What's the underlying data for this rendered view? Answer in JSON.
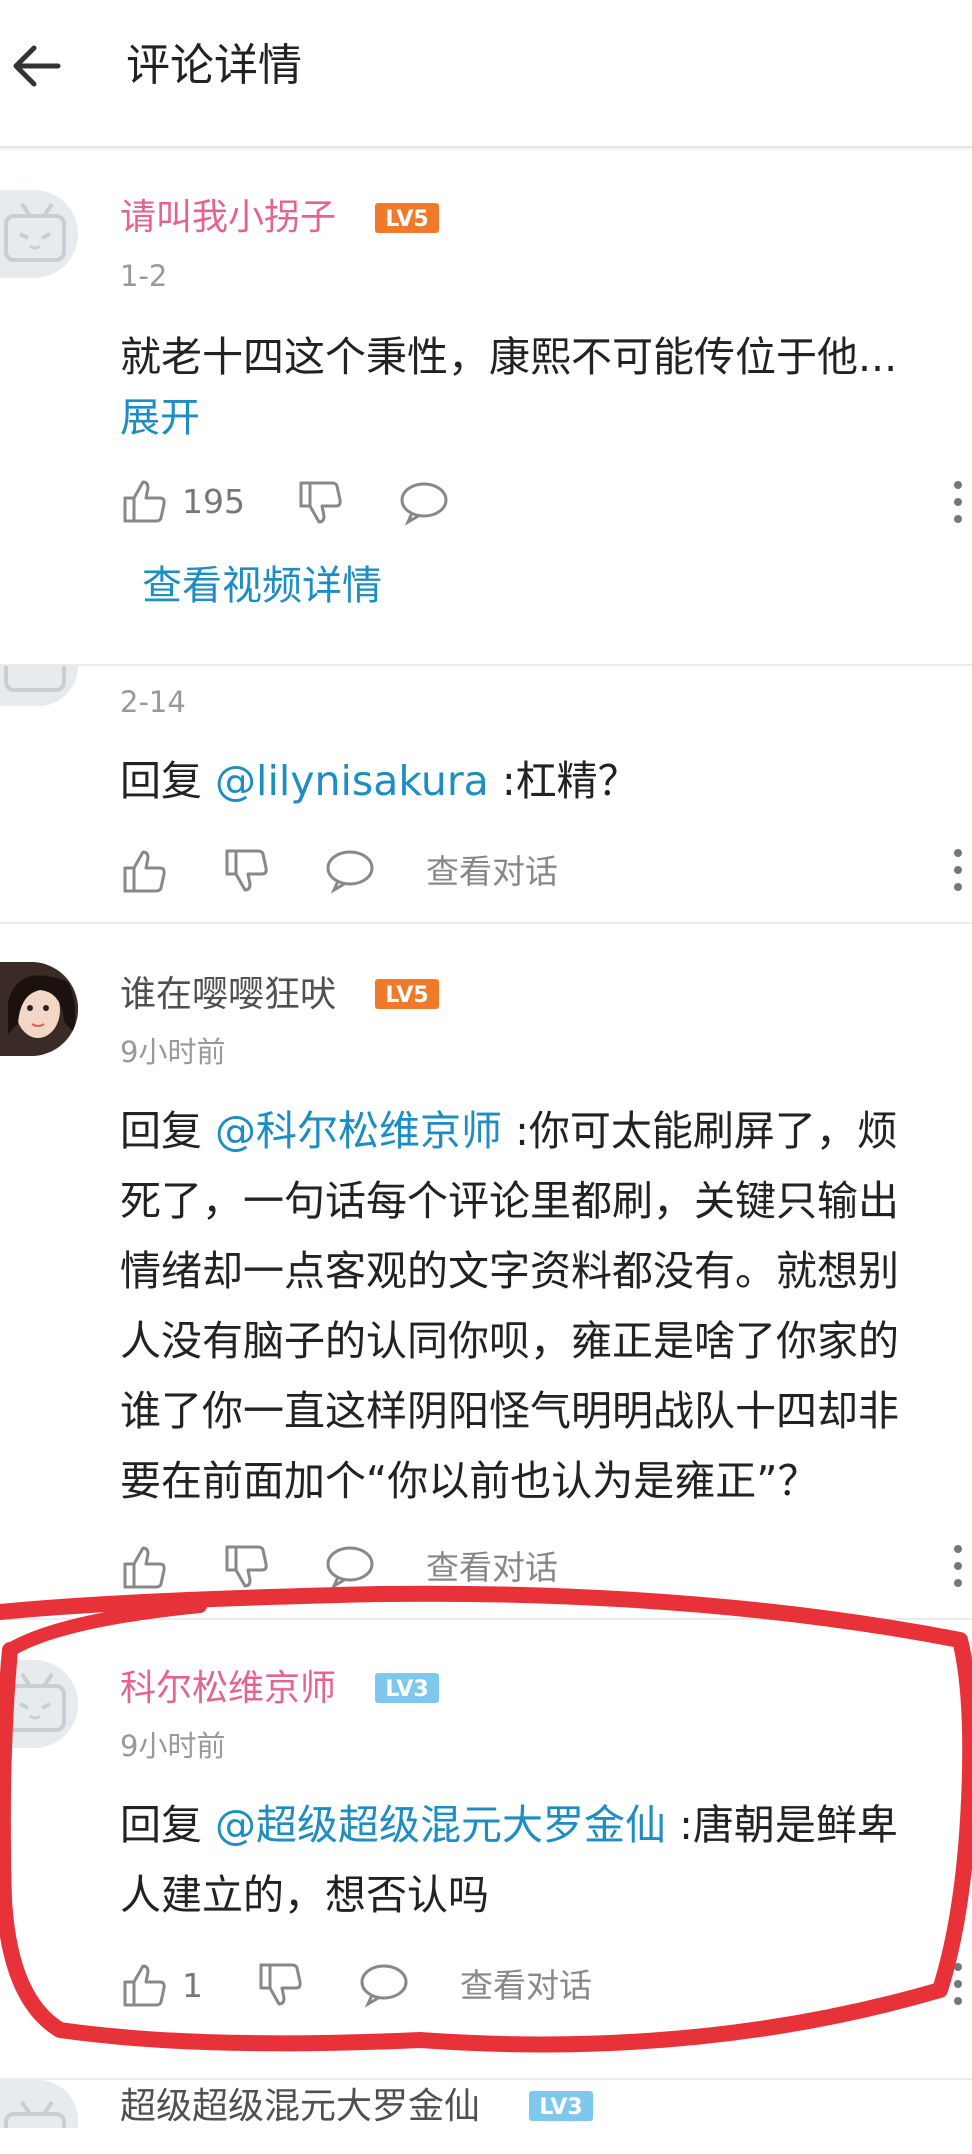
{
  "header": {
    "title": "评论详情"
  },
  "comments": [
    {
      "user": "请叫我小拐子",
      "level": "LV5",
      "date": "1-2",
      "text": "就老十四这个秉性，康熙不可能传位于他...",
      "expand": "展开",
      "likes": "195",
      "view_video": "查看视频详情"
    },
    {
      "date": "2-14",
      "reply_prefix": "回复 ",
      "mention": "@lilynisakura",
      "text": " :杠精？",
      "view_dialog": "查看对话"
    },
    {
      "user": "谁在嘤嘤狂吠",
      "level": "LV5",
      "date": "9小时前",
      "reply_prefix": "回复 ",
      "mention": "@科尔松维京师",
      "text_line1": " :你可太能刷屏了，烦",
      "text_rest": [
        "死了，一句话每个评论里都刷，关键只输出",
        "情绪却一点客观的文字资料都没有。就想别",
        "人没有脑子的认同你呗，雍正是啥了你家的",
        "谁了你一直这样阴阳怪气明明战队十四却非",
        "要在前面加个“你以前也认为是雍正”？"
      ],
      "view_dialog": "查看对话"
    },
    {
      "user": "科尔松维京师",
      "level": "LV3",
      "date": "9小时前",
      "reply_prefix": "回复 ",
      "mention": "@超级超级混元大罗金仙",
      "text_line1": " :唐朝是鲜卑",
      "text_line2": "人建立的，想否认吗",
      "likes": "1",
      "view_dialog": "查看对话"
    },
    {
      "user": "超级超级混元大罗金仙",
      "level": "LV3"
    }
  ],
  "colors": {
    "accent_blue": "#1d8dc3",
    "name_pink": "#e5648f",
    "lv5": "#f07a2a",
    "lv3": "#7ec8ee",
    "annotation": "#e8323a"
  }
}
